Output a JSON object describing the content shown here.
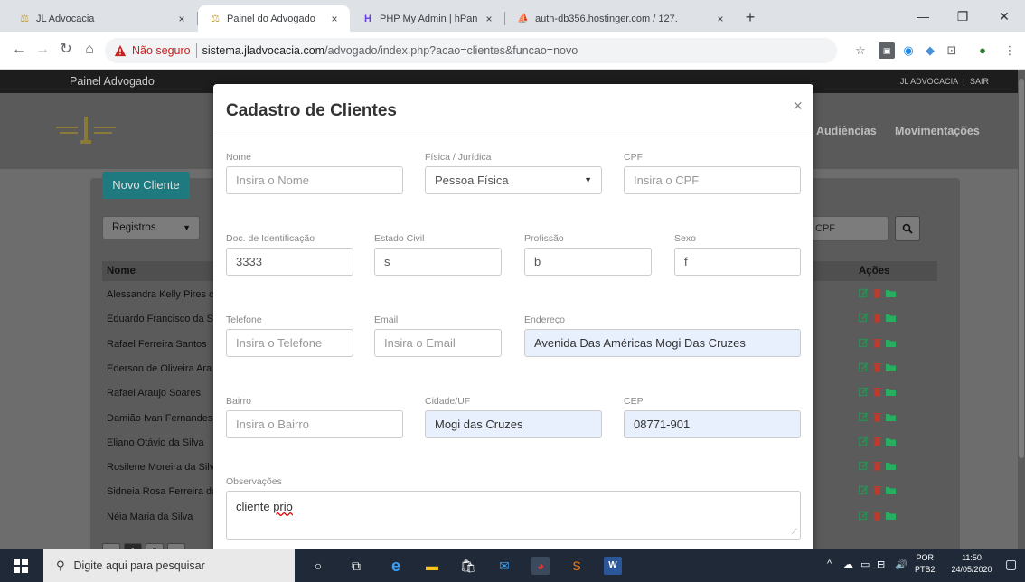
{
  "browser": {
    "tabs": [
      {
        "title": "JL Advocacia",
        "close": "×",
        "active": false
      },
      {
        "title": "Painel do Advogado",
        "close": "×",
        "active": true
      },
      {
        "title": "PHP My Admin | hPanel",
        "close": "×",
        "active": false
      },
      {
        "title": "auth-db356.hostinger.com / 127.",
        "close": "×",
        "active": false
      }
    ],
    "new_tab": "+",
    "security_label": "Não seguro",
    "url_host": "sistema.jladvocacia.com",
    "url_path": "/advogado/index.php?acao=clientes&funcao=novo"
  },
  "site": {
    "brand": "Painel Advogado",
    "top_links": [
      "JL ADVOCACIA",
      "SAIR"
    ],
    "top_sep": "|",
    "nav": [
      "Audiências",
      "Movimentações"
    ],
    "new_client_button": "Novo Cliente",
    "records_select": "Registros",
    "search_placeholder": "CPF",
    "table": {
      "col_name": "Nome",
      "col_actions": "Ações",
      "rows": [
        "Alessandra Kelly Pires c",
        "Eduardo Francisco da Si",
        "Rafael Ferreira Santos",
        "Ederson de Oliveira Ara",
        "Rafael Araujo Soares",
        "Damião Ivan Fernandes :",
        "Eliano Otávio da Silva",
        "Rosilene Moreira da Silv",
        "Sidneia Rosa Ferreira da",
        "Néia Maria da Silva"
      ]
    },
    "pages": [
      "‹",
      "1",
      "2",
      "›"
    ]
  },
  "modal": {
    "title": "Cadastro de Clientes",
    "close": "×",
    "fields": {
      "nome": {
        "label": "Nome",
        "placeholder": "Insira o Nome"
      },
      "tipo": {
        "label": "Física / Jurídica",
        "value": "Pessoa Física"
      },
      "cpf": {
        "label": "CPF",
        "placeholder": "Insira o CPF"
      },
      "doc": {
        "label": "Doc. de Identificação",
        "value": "3333"
      },
      "estado_civil": {
        "label": "Estado Civil",
        "value": "s"
      },
      "profissao": {
        "label": "Profissão",
        "value": "b"
      },
      "sexo": {
        "label": "Sexo",
        "value": "f"
      },
      "telefone": {
        "label": "Telefone",
        "placeholder": "Insira o Telefone"
      },
      "email": {
        "label": "Email",
        "placeholder": "Insira o Email"
      },
      "endereco": {
        "label": "Endereço",
        "value": "Avenida Das Américas Mogi Das Cruzes"
      },
      "bairro": {
        "label": "Bairro",
        "placeholder": "Insira o Bairro"
      },
      "cidade": {
        "label": "Cidade/UF",
        "value": "Mogi das Cruzes"
      },
      "cep": {
        "label": "CEP",
        "value": "08771-901"
      },
      "observacoes": {
        "label": "Observações",
        "value_prefix": "cliente ",
        "value_misspelled": "prio"
      }
    }
  },
  "taskbar": {
    "search_placeholder": "Digite aqui para pesquisar",
    "lang_top": "POR",
    "lang_bottom": "PTB2",
    "time": "11:50",
    "date": "24/05/2020"
  },
  "colors": {
    "accent_teal": "#1e7a7f",
    "edit_green": "#2e8b57",
    "delete_red": "#c0392b",
    "folder_green": "#27ae60",
    "autofill_bg": "#e8f0fe"
  }
}
